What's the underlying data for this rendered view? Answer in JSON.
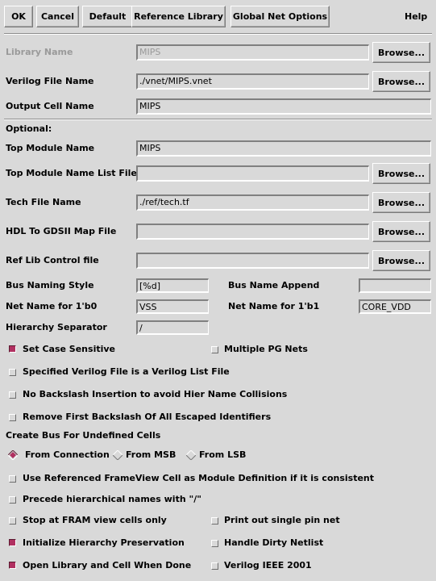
{
  "toolbar": {
    "ok": "OK",
    "cancel": "Cancel",
    "default": "Default",
    "reference_library": "Reference Library",
    "global_net_options": "Global Net Options",
    "help": "Help"
  },
  "required": {
    "library_name": {
      "label": "Library Name",
      "value": "MIPS",
      "disabled": true,
      "browse": "Browse..."
    },
    "verilog_file_name": {
      "label": "Verilog File Name",
      "value": "./vnet/MIPS.vnet",
      "browse": "Browse..."
    },
    "output_cell_name": {
      "label": "Output Cell Name",
      "value": "MIPS"
    }
  },
  "optional": {
    "heading": "Optional:",
    "top_module_name": {
      "label": "Top Module Name",
      "value": "MIPS"
    },
    "top_module_name_list_file": {
      "label": "Top Module Name List File",
      "value": "",
      "browse": "Browse..."
    },
    "tech_file_name": {
      "label": "Tech File Name",
      "value": "./ref/tech.tf",
      "browse": "Browse..."
    },
    "hdl_to_gdsii_map_file": {
      "label": "HDL To GDSII Map File",
      "value": "",
      "browse": "Browse..."
    },
    "ref_lib_control_file": {
      "label": "Ref Lib Control file",
      "value": "",
      "browse": "Browse..."
    },
    "bus_naming_style": {
      "label": "Bus Naming Style",
      "value": "[%d]"
    },
    "bus_name_append": {
      "label": "Bus Name Append",
      "value": ""
    },
    "net_name_1b0": {
      "label": "Net Name for 1'b0",
      "value": "VSS"
    },
    "net_name_1b1": {
      "label": "Net Name for 1'b1",
      "value": "CORE_VDD"
    },
    "hierarchy_separator": {
      "label": "Hierarchy Separator",
      "value": "/"
    }
  },
  "checkboxes": {
    "set_case_sensitive": {
      "label": "Set Case Sensitive",
      "checked": true
    },
    "multiple_pg_nets": {
      "label": "Multiple PG Nets",
      "checked": false
    },
    "verilog_list_file": {
      "label": "Specified Verilog File is a Verilog List File",
      "checked": false
    },
    "no_backslash_insertion": {
      "label": "No Backslash Insertion to avoid Hier Name Collisions",
      "checked": false
    },
    "remove_first_backslash": {
      "label": "Remove First Backslash Of All Escaped Identifiers",
      "checked": false
    },
    "use_referenced_frameview": {
      "label": "Use Referenced FrameView Cell as Module Definition if it is consistent",
      "checked": false
    },
    "precede_hier_names": {
      "label": "Precede hierarchical names with \"/\"",
      "checked": false
    },
    "stop_at_fram": {
      "label": "Stop at FRAM view cells only",
      "checked": false
    },
    "print_single_pin_net": {
      "label": "Print out single pin net",
      "checked": false
    },
    "init_hier_preservation": {
      "label": "Initialize Hierarchy Preservation",
      "checked": true
    },
    "handle_dirty_netlist": {
      "label": "Handle Dirty Netlist",
      "checked": false
    },
    "open_lib_cell_done": {
      "label": "Open Library and Cell When Done",
      "checked": true
    },
    "verilog_ieee_2001": {
      "label": "Verilog IEEE 2001",
      "checked": false
    }
  },
  "create_bus": {
    "heading": "Create Bus For Undefined Cells",
    "options": [
      {
        "label": "From Connection",
        "selected": true
      },
      {
        "label": "From MSB",
        "selected": false
      },
      {
        "label": "From LSB",
        "selected": false
      }
    ]
  },
  "colors": {
    "background": "#d9d9d9",
    "selected_indicator": "#b03060",
    "disabled_text": "#9a9a9a"
  }
}
